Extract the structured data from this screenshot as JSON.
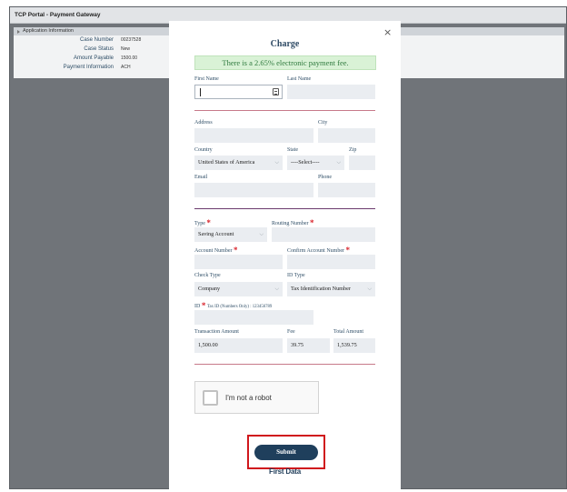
{
  "portal": {
    "title": "TCP Portal - Payment Gateway",
    "section_title": "Application Information",
    "rows": [
      {
        "label": "Case Number",
        "value": "00237528"
      },
      {
        "label": "Case Status",
        "value": "New"
      },
      {
        "label": "Amount Payable",
        "value": "1500.00"
      },
      {
        "label": "Payment Information",
        "value": "ACH"
      }
    ]
  },
  "modal": {
    "close_icon": "×",
    "title": "Charge",
    "fee_notice": "There is a 2.65% electronic payment fee.",
    "labels": {
      "first_name": "First Name",
      "last_name": "Last Name",
      "address": "Address",
      "city": "City",
      "country": "Country",
      "state": "State",
      "zip": "Zip",
      "email": "Email",
      "phone": "Phone",
      "type": "Type",
      "routing_number": "Routing Number",
      "account_number": "Account Number",
      "confirm_account_number": "Confirm Account Number",
      "check_type": "Check Type",
      "id_type": "ID Type",
      "id": "ID",
      "id_hint": "Tax ID (Numbers Only) : 123456789",
      "transaction_amount": "Transaction Amount",
      "fee": "Fee",
      "total_amount": "Total Amount",
      "required_mark": "*"
    },
    "values": {
      "first_name": "",
      "last_name": "",
      "address": "",
      "city": "",
      "country": "United States of America",
      "state": "----Select----",
      "zip": "",
      "email": "",
      "phone": "",
      "type": "Saving Account",
      "routing_number": "",
      "account_number": "",
      "confirm_account_number": "",
      "check_type": "Company",
      "id_type": "Tax Identification Number",
      "id": "",
      "transaction_amount": "1,500.00",
      "fee": "39.75",
      "total_amount": "1,539.75"
    },
    "captcha_label": "I'm not a robot",
    "submit_label": "Submit",
    "footer_brand": "First Data"
  },
  "icons": {
    "close": "close-icon",
    "chevron": "chevron-down-icon",
    "keyboard": "keyboard-icon"
  },
  "colors": {
    "accent": "#1f3f5c",
    "fee_banner_bg": "#d9f2d6",
    "fee_banner_text": "#2f7a3e",
    "required": "#d9252d",
    "submit_highlight": "#d0171c",
    "label": "#2f4e67"
  }
}
